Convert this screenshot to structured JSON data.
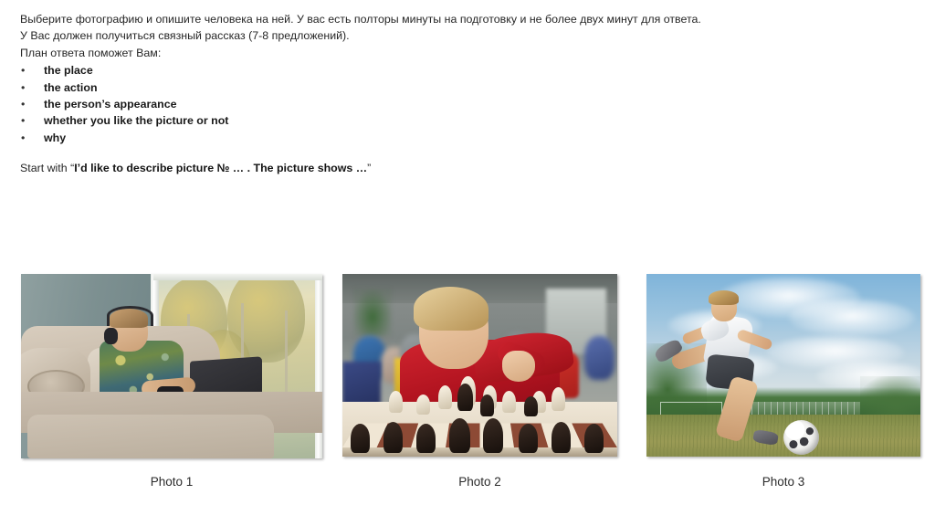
{
  "task": {
    "paragraphs": [
      "Выберите фотографию и опишите человека на ней. У вас есть полторы минуты на подготовку и не более двух минут для ответа.",
      "У Вас должен получиться связный рассказ (7-8 предложений).",
      "План ответа поможет Вам:"
    ],
    "plan_items": [
      "the place",
      "the action",
      "the person’s appearance",
      "whether you like the picture or not",
      "why"
    ],
    "bullet_glyph": "•",
    "start_prefix": "Start with “",
    "start_quote": "I’d like to describe picture № … . The picture shows …",
    "start_suffix": "”"
  },
  "photos": [
    {
      "caption": "Photo 1",
      "alt": "A boy wearing headphones sits on a beige sofa with his feet up, playing a video game with a gamepad in front of an open black laptop, next to a bright window."
    },
    {
      "caption": "Photo 2",
      "alt": "A blond boy in a red sweater leans over a chessboard and moves a white piece in a bright club room with other children blurred in the background."
    },
    {
      "caption": "Photo 3",
      "alt": "A boy in a white t-shirt and dark shorts runs and kicks a black-and-white football on a grass pitch under a cloudy blue sky."
    }
  ],
  "colors": {
    "text": "#262626",
    "background": "#ffffff",
    "caption": "#2b2b2b"
  }
}
